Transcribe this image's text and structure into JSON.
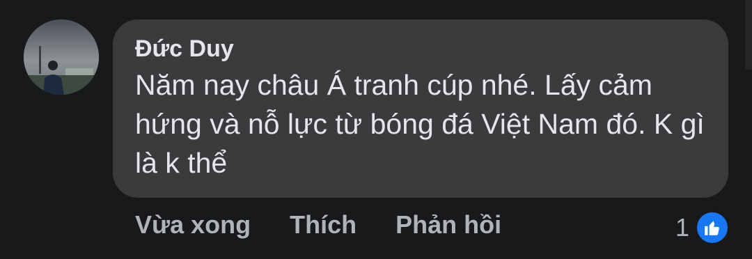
{
  "comment": {
    "author": "Đức Duy",
    "text": "Năm nay châu Á tranh cúp nhé. Lấy cảm hứng và nỗ lực từ bóng đá Việt Nam đó. K gì là k thể",
    "avatar_icon": "profile-photo",
    "actions": {
      "time": "Vừa xong",
      "like": "Thích",
      "reply": "Phản hồi"
    },
    "reactions": {
      "count": "1",
      "icon": "like-icon",
      "color": "#1877f2"
    }
  }
}
